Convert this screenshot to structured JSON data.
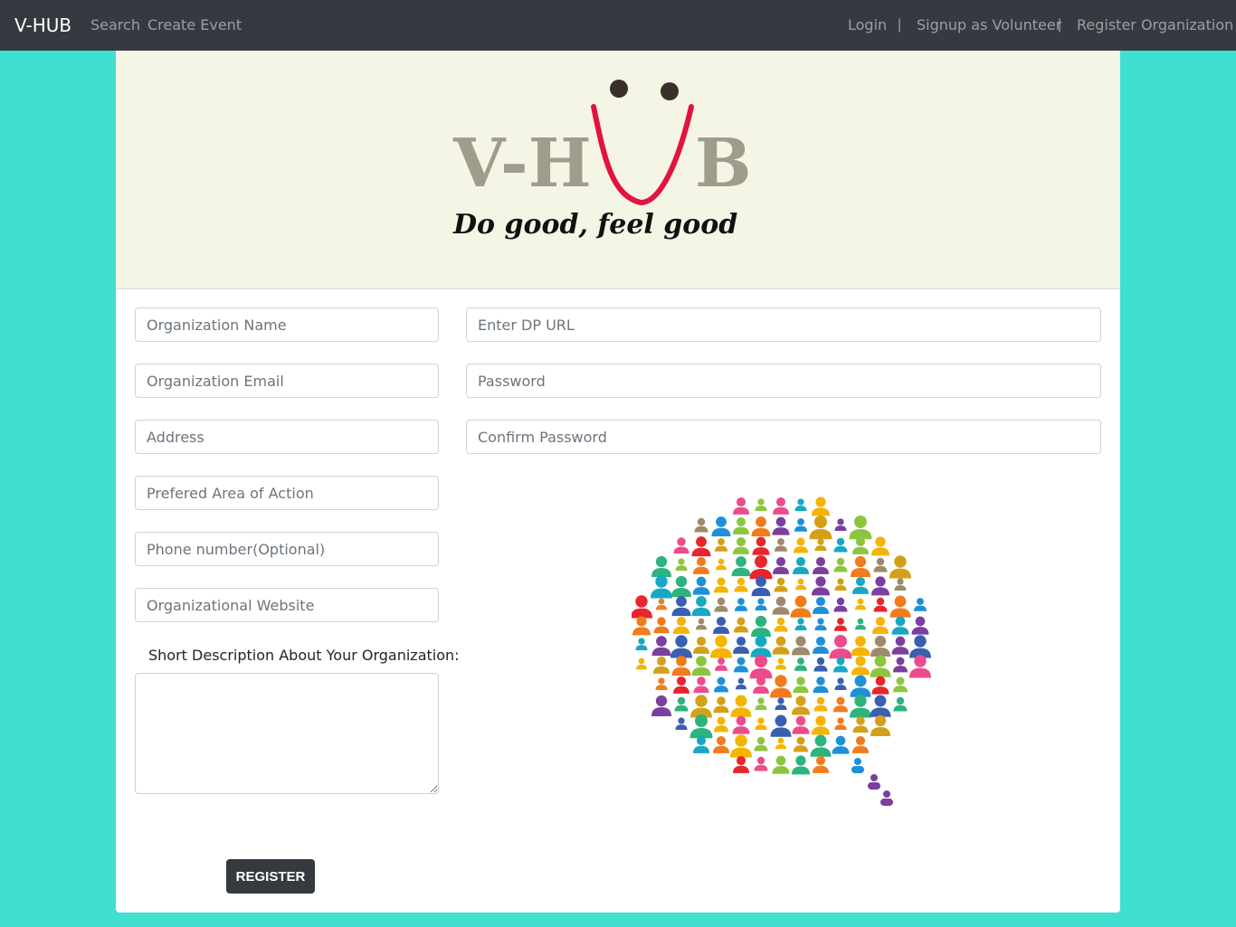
{
  "navbar": {
    "brand": "V-HUB",
    "search": "Search",
    "create_event": "Create Event",
    "login": "Login",
    "separator": "|",
    "signup": "Signup as Volunteer",
    "register_org": "Register Organization"
  },
  "banner": {
    "logo_text_left": "V-H",
    "logo_text_right": "B",
    "tagline": "Do good, feel good"
  },
  "form": {
    "org_name_placeholder": "Organization Name",
    "org_email_placeholder": "Organization Email",
    "address_placeholder": "Address",
    "area_placeholder": "Prefered Area of Action",
    "phone_placeholder": "Phone number(Optional)",
    "website_placeholder": "Organizational Website",
    "dp_url_placeholder": "Enter DP URL",
    "password_placeholder": "Password",
    "confirm_password_placeholder": "Confirm Password",
    "description_label": "Short Description About Your Organization:",
    "register_label": "REGISTER"
  },
  "colors": {
    "page_bg": "#40e0d0",
    "navbar_bg": "#343a40",
    "banner_bg": "#f5f5e6",
    "logo_gray": "#a09c8c",
    "logo_smile": "#e0143c"
  }
}
